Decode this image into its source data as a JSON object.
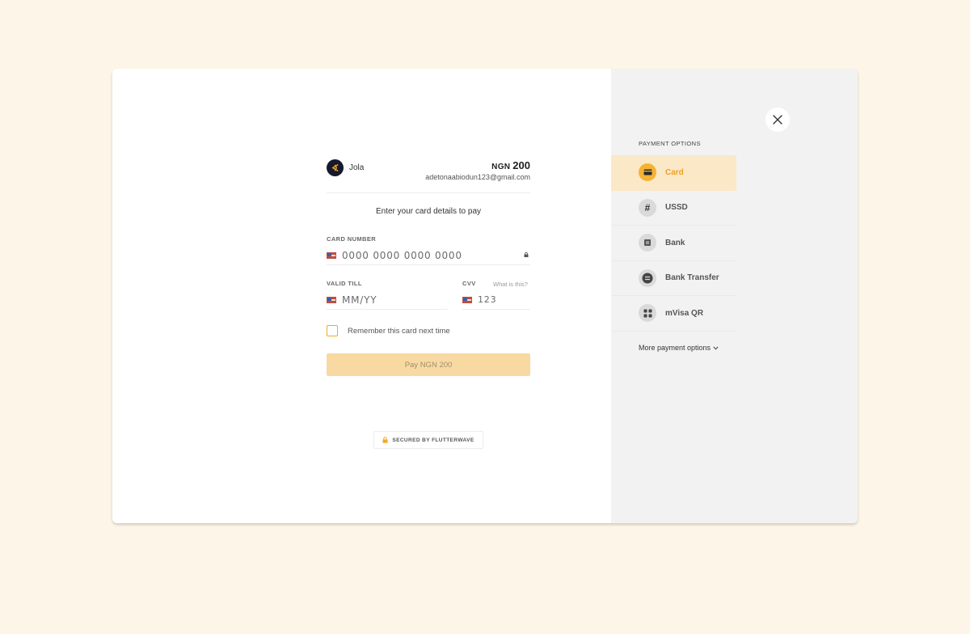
{
  "merchant": {
    "name": "Jola",
    "logo_icon": "flutterwave-logo-icon"
  },
  "payment": {
    "currency": "NGN",
    "amount": "200",
    "email": "adetonaabiodun123@gmail.com",
    "instruction": "Enter your card details to pay"
  },
  "form": {
    "card_number_label": "CARD NUMBER",
    "card_number_placeholder": "0000 0000 0000 0000",
    "valid_till_label": "VALID TILL",
    "valid_till_placeholder": "MM/YY",
    "cvv_label": "CVV",
    "cvv_placeholder": "123",
    "cvv_help": "What is this?",
    "remember_label": "Remember this card next time",
    "pay_button": "Pay NGN 200"
  },
  "footer": {
    "secured_text": "SECURED BY FLUTTERWAVE"
  },
  "sidebar": {
    "title": "PAYMENT OPTIONS",
    "options": [
      {
        "label": "Card",
        "icon": "card-icon",
        "active": true
      },
      {
        "label": "USSD",
        "icon": "hash-icon",
        "active": false
      },
      {
        "label": "Bank",
        "icon": "bank-icon",
        "active": false
      },
      {
        "label": "Bank Transfer",
        "icon": "transfer-icon",
        "active": false
      },
      {
        "label": "mVisa QR",
        "icon": "qr-icon",
        "active": false
      }
    ],
    "more_options": "More payment options"
  },
  "colors": {
    "accent": "#f5a623",
    "active_bg": "#fbe8c6",
    "pay_button_bg": "#f8d9a2",
    "page_bg": "#fdf5e7"
  }
}
